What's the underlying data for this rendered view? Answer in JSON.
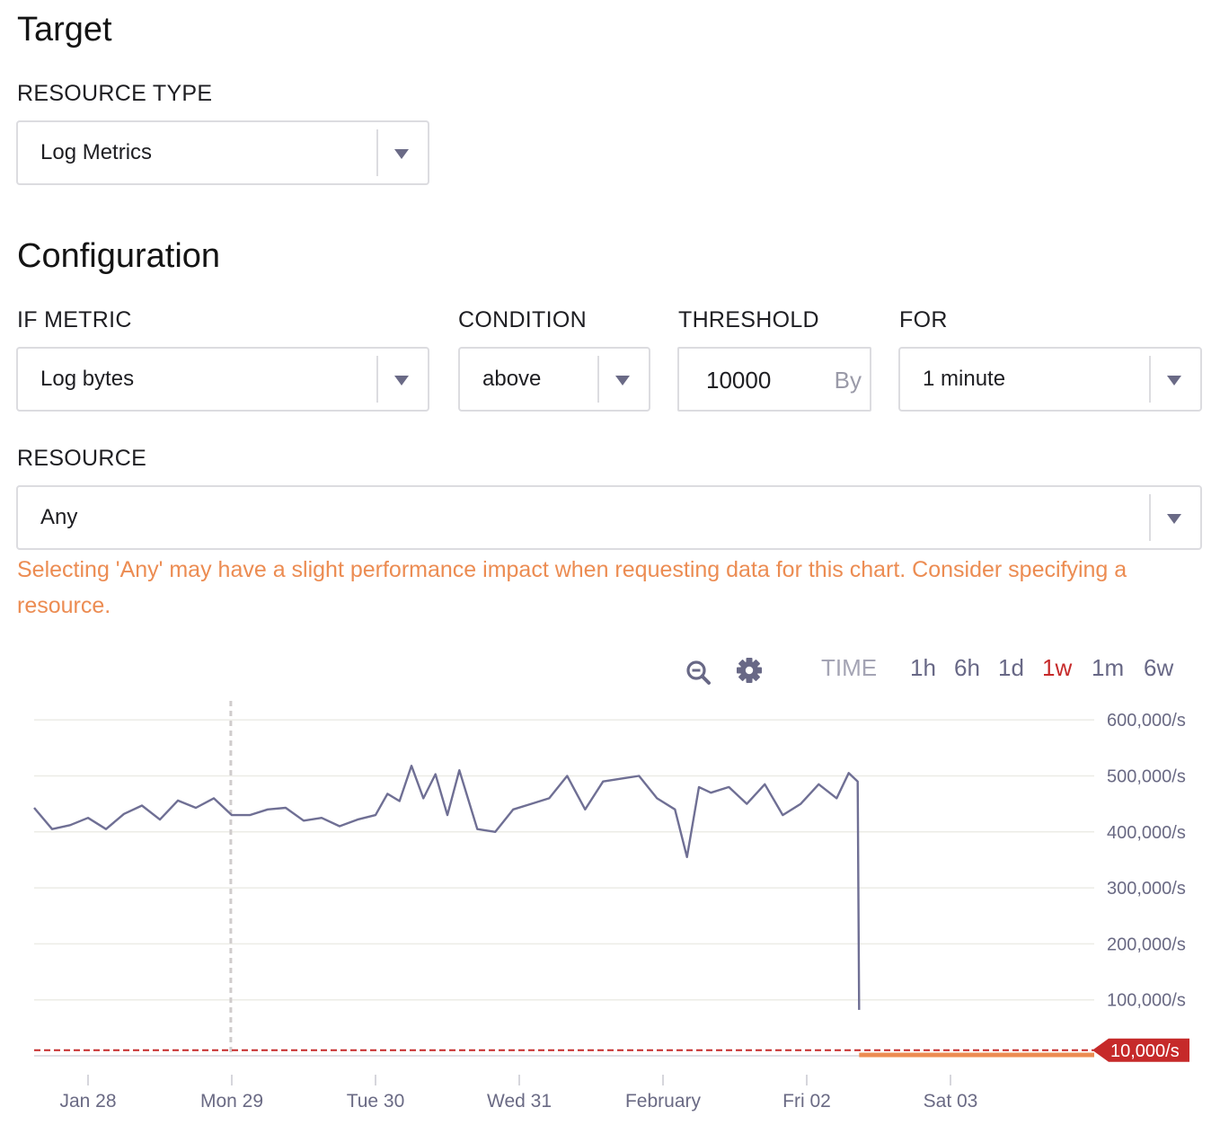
{
  "target": {
    "heading": "Target",
    "resource_type_label": "RESOURCE TYPE",
    "resource_type_value": "Log Metrics"
  },
  "configuration": {
    "heading": "Configuration",
    "if_metric_label": "IF METRIC",
    "if_metric_value": "Log bytes",
    "condition_label": "CONDITION",
    "condition_value": "above",
    "threshold_label": "THRESHOLD",
    "threshold_value": "10000",
    "threshold_unit": "By",
    "for_label": "FOR",
    "for_value": "1 minute",
    "resource_label": "RESOURCE",
    "resource_value": "Any",
    "warning": "Selecting 'Any' may have a slight performance impact when requesting data for this chart. Consider specifying a resource."
  },
  "toolbar": {
    "zoom_icon": "zoom-out-icon",
    "settings_icon": "gear-icon",
    "time_label": "TIME",
    "ranges": [
      "1h",
      "6h",
      "1d",
      "1w",
      "1m",
      "6w"
    ],
    "active_range": "1w"
  },
  "colors": {
    "series": "#6f6f94",
    "threshold": "#c62a2a",
    "active_range": "#c62a2a",
    "warning": "#ec8c52",
    "low_series": "#ec8c52"
  },
  "chart_data": {
    "type": "line",
    "ylabel": "",
    "ylim": [
      0,
      650000
    ],
    "yticks": [
      100000,
      200000,
      300000,
      400000,
      500000,
      600000
    ],
    "ytick_labels": [
      "100,000/s",
      "200,000/s",
      "300,000/s",
      "400,000/s",
      "500,000/s",
      "600,000/s"
    ],
    "xlim": [
      "2018-01-27T15:00",
      "2018-02-04T00:00"
    ],
    "xticks": [
      "2018-01-28",
      "2018-01-29",
      "2018-01-30",
      "2018-01-31",
      "2018-02-01",
      "2018-02-02",
      "2018-02-03"
    ],
    "xtick_labels": [
      "Jan 28",
      "Mon 29",
      "Tue 30",
      "Wed 31",
      "February",
      "Fri 02",
      "Sat 03"
    ],
    "cursor_time": "2018-01-28T23:50",
    "threshold": {
      "value": 10000,
      "label": "10,000/s"
    },
    "series": [
      {
        "times": [
          "2018-01-27T15:00",
          "2018-01-27T18:00",
          "2018-01-27T21:00",
          "2018-01-28T00:00",
          "2018-01-28T03:00",
          "2018-01-28T06:00",
          "2018-01-28T09:00",
          "2018-01-28T12:00",
          "2018-01-28T15:00",
          "2018-01-28T18:00",
          "2018-01-28T21:00",
          "2018-01-29T00:00",
          "2018-01-29T03:00",
          "2018-01-29T06:00",
          "2018-01-29T09:00",
          "2018-01-29T12:00",
          "2018-01-29T15:00",
          "2018-01-29T18:00",
          "2018-01-29T21:00",
          "2018-01-30T00:00",
          "2018-01-30T02:00",
          "2018-01-30T04:00",
          "2018-01-30T06:00",
          "2018-01-30T08:00",
          "2018-01-30T10:00",
          "2018-01-30T12:00",
          "2018-01-30T14:00",
          "2018-01-30T17:00",
          "2018-01-30T20:00",
          "2018-01-30T23:00",
          "2018-01-31T02:00",
          "2018-01-31T05:00",
          "2018-01-31T08:00",
          "2018-01-31T11:00",
          "2018-01-31T14:00",
          "2018-01-31T17:00",
          "2018-01-31T20:00",
          "2018-01-31T23:00",
          "2018-02-01T02:00",
          "2018-02-01T04:00",
          "2018-02-01T06:00",
          "2018-02-01T08:00",
          "2018-02-01T11:00",
          "2018-02-01T14:00",
          "2018-02-01T17:00",
          "2018-02-01T20:00",
          "2018-02-01T23:00",
          "2018-02-02T02:00",
          "2018-02-02T05:00",
          "2018-02-02T07:00",
          "2018-02-02T08:30",
          "2018-02-02T08:45"
        ],
        "values": [
          443000,
          405000,
          412000,
          425000,
          405000,
          432000,
          447000,
          422000,
          456000,
          443000,
          460000,
          430000,
          430000,
          440000,
          443000,
          420000,
          425000,
          410000,
          422000,
          430000,
          468000,
          455000,
          518000,
          460000,
          503000,
          430000,
          510000,
          405000,
          400000,
          440000,
          450000,
          460000,
          500000,
          440000,
          490000,
          495000,
          500000,
          460000,
          440000,
          355000,
          480000,
          470000,
          480000,
          450000,
          485000,
          430000,
          450000,
          485000,
          460000,
          505000,
          490000,
          82000
        ]
      }
    ]
  }
}
